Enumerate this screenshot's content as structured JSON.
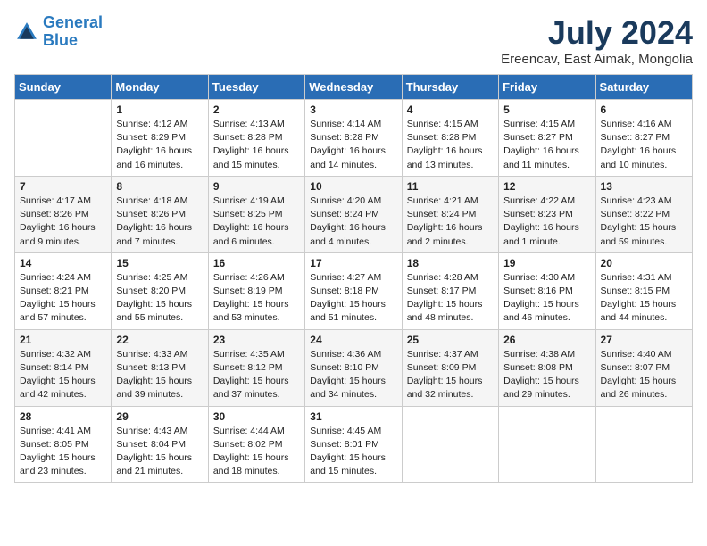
{
  "logo": {
    "line1": "General",
    "line2": "Blue"
  },
  "title": "July 2024",
  "location": "Ereencav, East Aimak, Mongolia",
  "weekdays": [
    "Sunday",
    "Monday",
    "Tuesday",
    "Wednesday",
    "Thursday",
    "Friday",
    "Saturday"
  ],
  "weeks": [
    [
      {
        "day": "",
        "text": ""
      },
      {
        "day": "1",
        "text": "Sunrise: 4:12 AM\nSunset: 8:29 PM\nDaylight: 16 hours\nand 16 minutes."
      },
      {
        "day": "2",
        "text": "Sunrise: 4:13 AM\nSunset: 8:28 PM\nDaylight: 16 hours\nand 15 minutes."
      },
      {
        "day": "3",
        "text": "Sunrise: 4:14 AM\nSunset: 8:28 PM\nDaylight: 16 hours\nand 14 minutes."
      },
      {
        "day": "4",
        "text": "Sunrise: 4:15 AM\nSunset: 8:28 PM\nDaylight: 16 hours\nand 13 minutes."
      },
      {
        "day": "5",
        "text": "Sunrise: 4:15 AM\nSunset: 8:27 PM\nDaylight: 16 hours\nand 11 minutes."
      },
      {
        "day": "6",
        "text": "Sunrise: 4:16 AM\nSunset: 8:27 PM\nDaylight: 16 hours\nand 10 minutes."
      }
    ],
    [
      {
        "day": "7",
        "text": "Sunrise: 4:17 AM\nSunset: 8:26 PM\nDaylight: 16 hours\nand 9 minutes."
      },
      {
        "day": "8",
        "text": "Sunrise: 4:18 AM\nSunset: 8:26 PM\nDaylight: 16 hours\nand 7 minutes."
      },
      {
        "day": "9",
        "text": "Sunrise: 4:19 AM\nSunset: 8:25 PM\nDaylight: 16 hours\nand 6 minutes."
      },
      {
        "day": "10",
        "text": "Sunrise: 4:20 AM\nSunset: 8:24 PM\nDaylight: 16 hours\nand 4 minutes."
      },
      {
        "day": "11",
        "text": "Sunrise: 4:21 AM\nSunset: 8:24 PM\nDaylight: 16 hours\nand 2 minutes."
      },
      {
        "day": "12",
        "text": "Sunrise: 4:22 AM\nSunset: 8:23 PM\nDaylight: 16 hours\nand 1 minute."
      },
      {
        "day": "13",
        "text": "Sunrise: 4:23 AM\nSunset: 8:22 PM\nDaylight: 15 hours\nand 59 minutes."
      }
    ],
    [
      {
        "day": "14",
        "text": "Sunrise: 4:24 AM\nSunset: 8:21 PM\nDaylight: 15 hours\nand 57 minutes."
      },
      {
        "day": "15",
        "text": "Sunrise: 4:25 AM\nSunset: 8:20 PM\nDaylight: 15 hours\nand 55 minutes."
      },
      {
        "day": "16",
        "text": "Sunrise: 4:26 AM\nSunset: 8:19 PM\nDaylight: 15 hours\nand 53 minutes."
      },
      {
        "day": "17",
        "text": "Sunrise: 4:27 AM\nSunset: 8:18 PM\nDaylight: 15 hours\nand 51 minutes."
      },
      {
        "day": "18",
        "text": "Sunrise: 4:28 AM\nSunset: 8:17 PM\nDaylight: 15 hours\nand 48 minutes."
      },
      {
        "day": "19",
        "text": "Sunrise: 4:30 AM\nSunset: 8:16 PM\nDaylight: 15 hours\nand 46 minutes."
      },
      {
        "day": "20",
        "text": "Sunrise: 4:31 AM\nSunset: 8:15 PM\nDaylight: 15 hours\nand 44 minutes."
      }
    ],
    [
      {
        "day": "21",
        "text": "Sunrise: 4:32 AM\nSunset: 8:14 PM\nDaylight: 15 hours\nand 42 minutes."
      },
      {
        "day": "22",
        "text": "Sunrise: 4:33 AM\nSunset: 8:13 PM\nDaylight: 15 hours\nand 39 minutes."
      },
      {
        "day": "23",
        "text": "Sunrise: 4:35 AM\nSunset: 8:12 PM\nDaylight: 15 hours\nand 37 minutes."
      },
      {
        "day": "24",
        "text": "Sunrise: 4:36 AM\nSunset: 8:10 PM\nDaylight: 15 hours\nand 34 minutes."
      },
      {
        "day": "25",
        "text": "Sunrise: 4:37 AM\nSunset: 8:09 PM\nDaylight: 15 hours\nand 32 minutes."
      },
      {
        "day": "26",
        "text": "Sunrise: 4:38 AM\nSunset: 8:08 PM\nDaylight: 15 hours\nand 29 minutes."
      },
      {
        "day": "27",
        "text": "Sunrise: 4:40 AM\nSunset: 8:07 PM\nDaylight: 15 hours\nand 26 minutes."
      }
    ],
    [
      {
        "day": "28",
        "text": "Sunrise: 4:41 AM\nSunset: 8:05 PM\nDaylight: 15 hours\nand 23 minutes."
      },
      {
        "day": "29",
        "text": "Sunrise: 4:43 AM\nSunset: 8:04 PM\nDaylight: 15 hours\nand 21 minutes."
      },
      {
        "day": "30",
        "text": "Sunrise: 4:44 AM\nSunset: 8:02 PM\nDaylight: 15 hours\nand 18 minutes."
      },
      {
        "day": "31",
        "text": "Sunrise: 4:45 AM\nSunset: 8:01 PM\nDaylight: 15 hours\nand 15 minutes."
      },
      {
        "day": "",
        "text": ""
      },
      {
        "day": "",
        "text": ""
      },
      {
        "day": "",
        "text": ""
      }
    ]
  ]
}
